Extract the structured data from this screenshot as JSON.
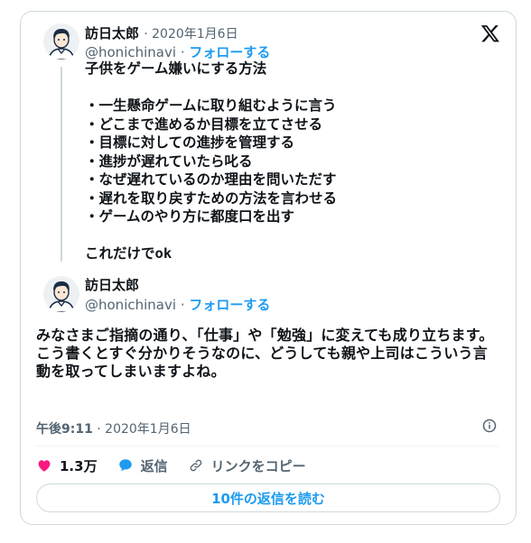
{
  "tweet1": {
    "author_name": "訪日太郎",
    "date": "· 2020年1月6日",
    "handle": "@honichinavi",
    "separator": "·",
    "follow_label": "フォローする",
    "text": "子供をゲーム嫌いにする方法\n\n・一生懸命ゲームに取り組むように言う\n・どこまで進めるか目標を立てさせる\n・目標に対しての進捗を管理する\n・進捗が遅れていたら叱る\n・なぜ遅れているのか理由を問いただす\n・遅れを取り戻すための方法を言わせる\n・ゲームのやり方に都度口を出す\n\nこれだけでok"
  },
  "tweet2": {
    "author_name": "訪日太郎",
    "handle": "@honichinavi",
    "separator": "·",
    "follow_label": "フォローする",
    "text": "みなさまご指摘の通り、「仕事」や「勉強」に変えても成り立ちます。\nこう書くとすぐ分かりそうなのに、どうしても親や上司はこういう言動を取ってしまいますよね。",
    "time": "午後9:11",
    "date": "· 2020年1月6日"
  },
  "actions": {
    "like_count": "1.3万",
    "reply_label": "返信",
    "copy_link_label": "リンクをコピー"
  },
  "read_replies_label": "10件の返信を読む",
  "colors": {
    "accent": "#1d9bf0",
    "like": "#f91880",
    "muted": "#536471",
    "border": "#cfd9de"
  }
}
